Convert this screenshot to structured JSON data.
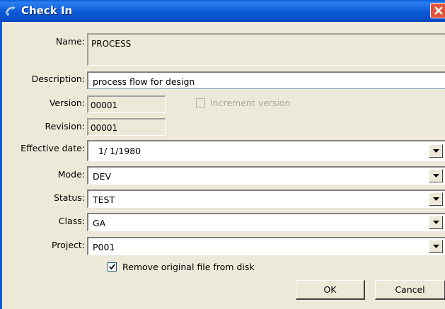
{
  "window": {
    "title": "Check In"
  },
  "labels": {
    "name": "Name:",
    "description": "Description:",
    "version": "Version:",
    "revision": "Revision:",
    "effective_date": "Effective date:",
    "mode": "Mode:",
    "status": "Status:",
    "class": "Class:",
    "project": "Project:"
  },
  "fields": {
    "name": "PROCESS",
    "description": "process flow for design",
    "version": "00001",
    "revision": "00001",
    "effective_date": "1/ 1/1980",
    "mode": "DEV",
    "status": "TEST",
    "class": "GA",
    "project": "P001"
  },
  "checkboxes": {
    "increment_version": {
      "label": "Increment version",
      "checked": false,
      "enabled": false
    },
    "remove_original": {
      "label": "Remove original file from disk",
      "checked": true,
      "enabled": true
    }
  },
  "buttons": {
    "ok": "OK",
    "cancel": "Cancel"
  },
  "colors": {
    "titlebar": "#0c5ad6",
    "dialog_bg": "#ece9d8",
    "close": "#e0533a"
  }
}
